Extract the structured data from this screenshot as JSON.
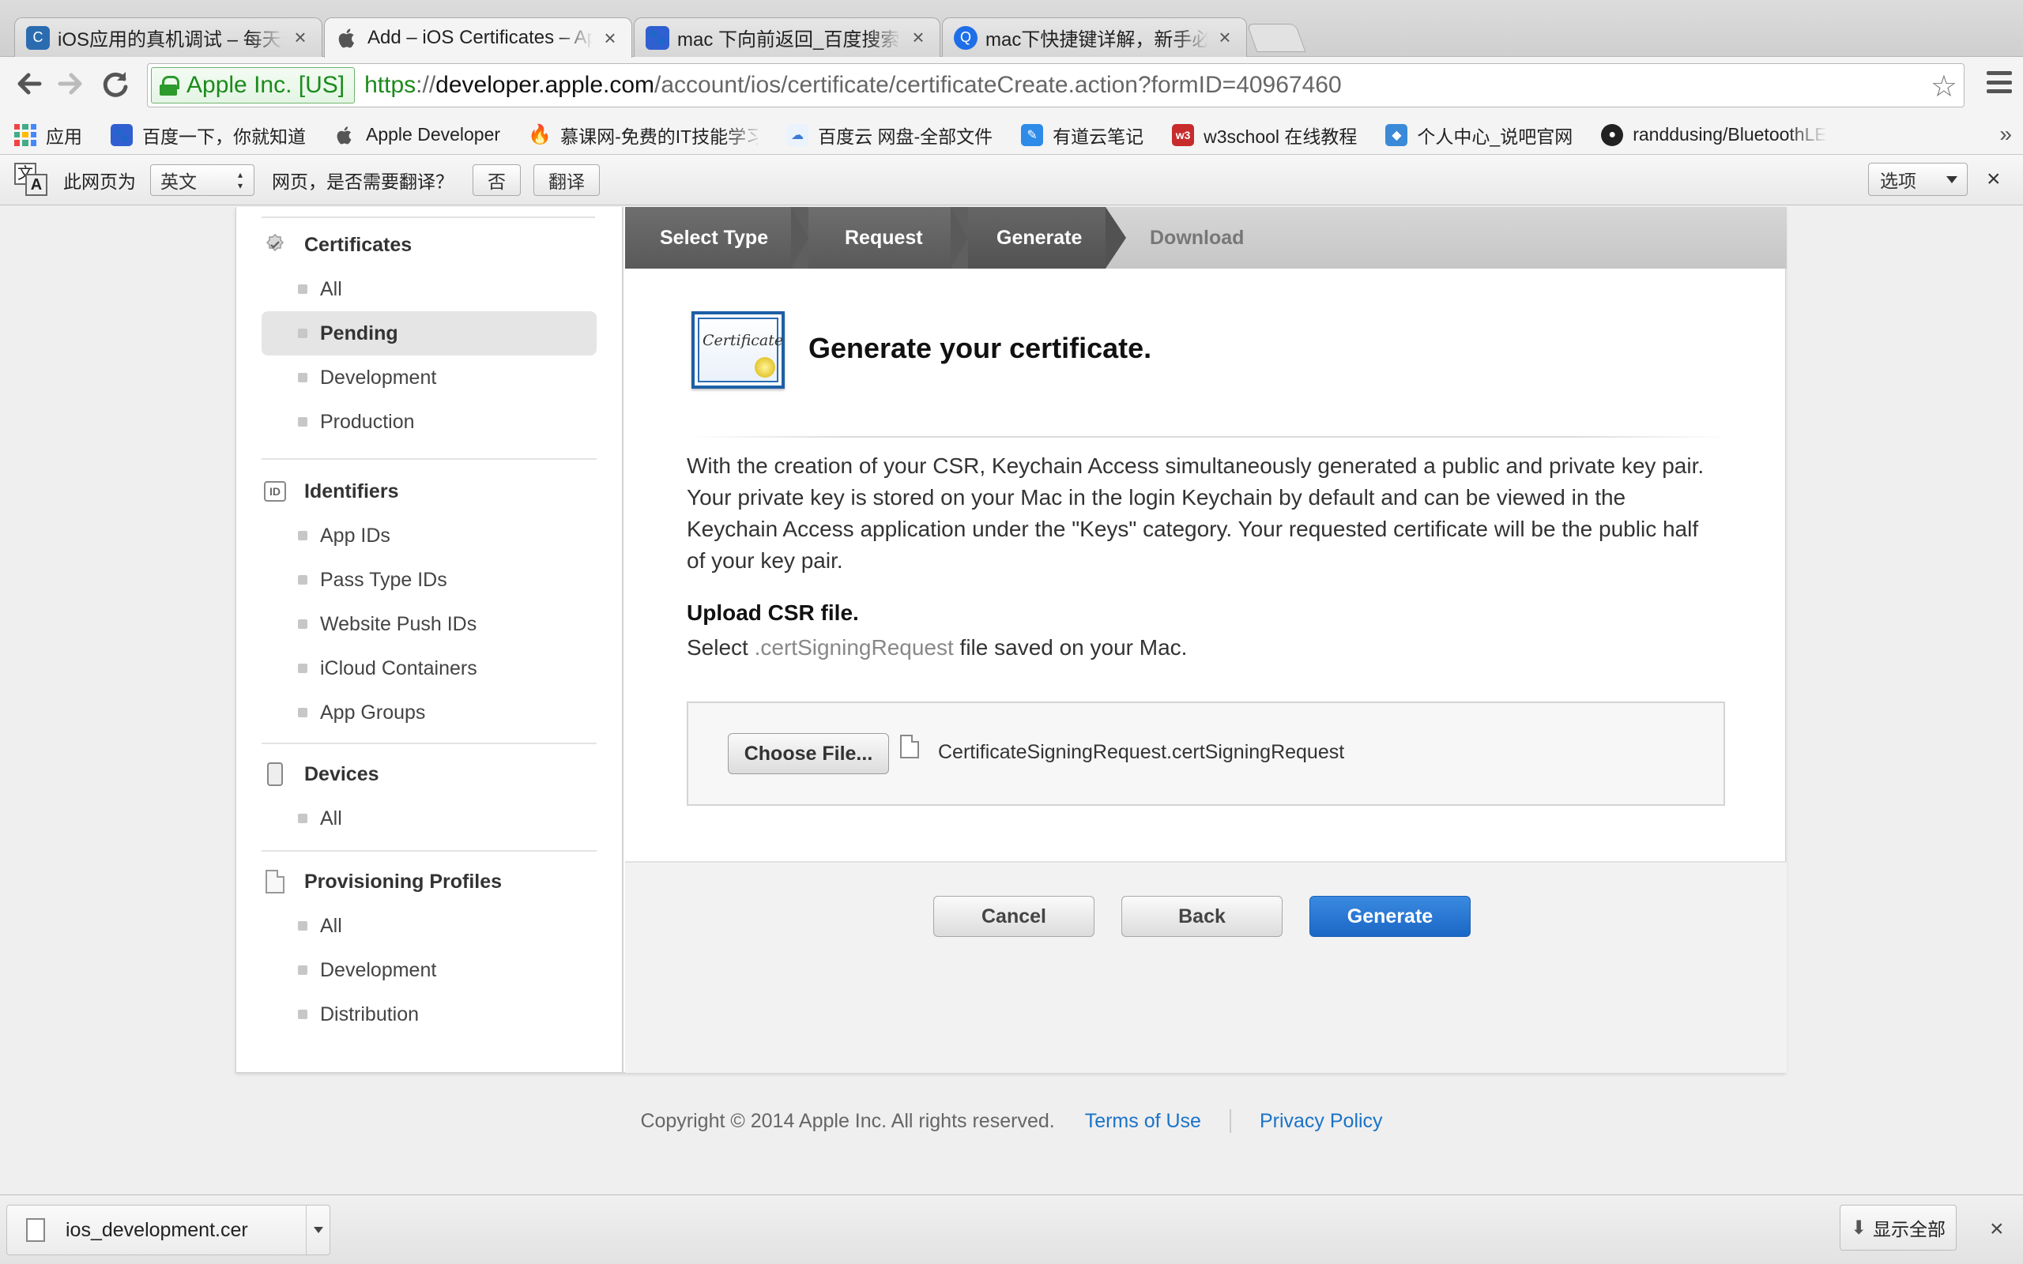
{
  "tabs": [
    {
      "title": "iOS应用的真机调试 – 每天进步",
      "close": "×",
      "favicon_color": "#2b6cb0",
      "favicon_glyph": "C"
    },
    {
      "title": "Add – iOS Certificates – Apple Developer",
      "close": "×",
      "favicon_color": "#555555",
      "favicon_glyph": ""
    },
    {
      "title": "mac 下向前返回_百度搜索",
      "close": "×",
      "favicon_color": "#2f5fd0",
      "favicon_glyph": "🐾"
    },
    {
      "title": "mac下快捷键详解，新手必读",
      "close": "×",
      "favicon_color": "#1e6ee8",
      "favicon_glyph": "Q"
    }
  ],
  "toolbar": {
    "back_icon": "back-arrow-icon",
    "forward_icon": "forward-arrow-icon",
    "reload_icon": "reload-icon",
    "ev_label": "Apple Inc. [US]",
    "url_scheme": "https",
    "url_sep": "://",
    "url_host": "developer.apple.com",
    "url_path": "/account/ios/certificate/certificateCreate.action?formID=40967460"
  },
  "bookmarks": [
    {
      "label": "应用",
      "icon": "apps-grid-icon"
    },
    {
      "label": "百度一下，你就知道",
      "icon": "baidu-paw-icon",
      "color": "#2f5fd0"
    },
    {
      "label": "Apple Developer",
      "icon": "apple-icon",
      "color": "#555555"
    },
    {
      "label": "慕课网-免费的IT技能学习",
      "icon": "flame-icon",
      "color": "#e4322b"
    },
    {
      "label": "百度云 网盘-全部文件",
      "icon": "baidu-cloud-icon",
      "color": "#3a7bd5"
    },
    {
      "label": "有道云笔记",
      "icon": "youdao-note-icon",
      "color": "#2e8be8"
    },
    {
      "label": "w3school 在线教程",
      "icon": "w3school-icon",
      "color": "#c72b2b"
    },
    {
      "label": "个人中心_说吧官网",
      "icon": "shuoba-icon",
      "color": "#3b8ad8"
    },
    {
      "label": "randdusing/BluetoothLE",
      "icon": "github-icon",
      "color": "#222222"
    }
  ],
  "translate": {
    "prefix": "此网页为",
    "language": "英文",
    "question": "网页，是否需要翻译？",
    "no_label": "否",
    "translate_label": "翻译",
    "options_label": "选项",
    "close": "×"
  },
  "sidebar": {
    "sections": [
      {
        "title": "Certificates",
        "icon": "certificate-seal-icon",
        "items": [
          "All",
          "Pending",
          "Development",
          "Production"
        ],
        "active": "Pending"
      },
      {
        "title": "Identifiers",
        "icon": "id-badge-icon",
        "badge": "ID",
        "items": [
          "App IDs",
          "Pass Type IDs",
          "Website Push IDs",
          "iCloud Containers",
          "App Groups"
        ]
      },
      {
        "title": "Devices",
        "icon": "device-phone-icon",
        "items": [
          "All"
        ]
      },
      {
        "title": "Provisioning Profiles",
        "icon": "document-icon",
        "items": [
          "All",
          "Development",
          "Distribution"
        ]
      }
    ]
  },
  "steps": [
    "Select Type",
    "Request",
    "Generate",
    "Download"
  ],
  "content": {
    "cert_icon_text": "Certificate",
    "title": "Generate your certificate.",
    "paragraph": "With the creation of your CSR, Keychain Access simultaneously generated a public and private key pair. Your private key is stored on your Mac in the login Keychain by default and can be viewed in the Keychain Access application under the \"Keys\" category. Your requested certificate will be the public half of your key pair.",
    "upload_heading": "Upload CSR file.",
    "upload_sub_pre": "Select ",
    "upload_sub_code": ".certSigningRequest",
    "upload_sub_post": " file saved on your Mac.",
    "choose_file_label": "Choose File...",
    "file_name": "CertificateSigningRequest.certSigningRequest",
    "cancel_label": "Cancel",
    "back_label": "Back",
    "generate_label": "Generate"
  },
  "footer": {
    "copyright": "Copyright © 2014 Apple Inc. All rights reserved.",
    "terms": "Terms of Use",
    "privacy": "Privacy Policy"
  },
  "download_shelf": {
    "file": "ios_development.cer",
    "show_all": "显示全部",
    "close": "×"
  },
  "colors": {
    "accent_blue": "#1b67c6",
    "link_blue": "#1a73c8",
    "ev_green": "#1b8a1b"
  }
}
